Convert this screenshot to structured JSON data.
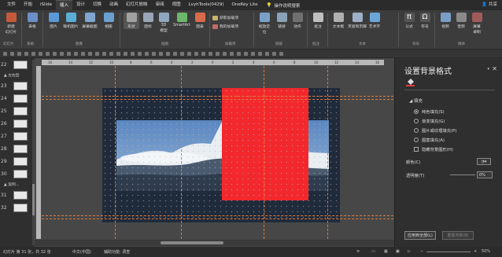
{
  "tabs": [
    {
      "label": "文件"
    },
    {
      "label": "开始"
    },
    {
      "label": "iSlide"
    },
    {
      "label": "插入",
      "active": true
    },
    {
      "label": "设计"
    },
    {
      "label": "切换"
    },
    {
      "label": "动画"
    },
    {
      "label": "幻灯片放映"
    },
    {
      "label": "审阅"
    },
    {
      "label": "视图"
    },
    {
      "label": "LvyhTools(0429)"
    },
    {
      "label": "OneKey Lite"
    }
  ],
  "tell_me": "操作说明搜索",
  "share": "共享",
  "ribbon": {
    "new_slide": "新建\n幻灯片",
    "table": "表格",
    "picture": "图片",
    "online_picture": "联机图片",
    "screenshot": "屏幕截图",
    "album": "相册",
    "shapes": "形状",
    "icons": "图标",
    "model3d": "3D\n模型",
    "smartart": "SmartArt",
    "chart": "图表",
    "get_addins": "获取加载项",
    "my_addins": "我的加载项",
    "zoom": "缩放定\n位",
    "link": "链接",
    "action": "动作",
    "comment": "批注",
    "textbox": "文本框",
    "header_footer": "页眉和页脚",
    "wordart": "艺术字",
    "formula": "公式",
    "symbol": "符号",
    "video": "视频",
    "audio": "音频",
    "screen_record": "屏幕\n录制",
    "groups": {
      "slides": "幻灯片",
      "table": "表格",
      "images": "图像",
      "illustrations": "插图",
      "addins": "加载项",
      "links": "链接",
      "comments": "批注",
      "text": "文本",
      "symbols": "符号",
      "media": "媒体"
    }
  },
  "thumbnails": [
    {
      "num": "22"
    },
    {
      "section": "▲ 左右型"
    },
    {
      "num": "23"
    },
    {
      "num": "24"
    },
    {
      "num": "25"
    },
    {
      "num": "26"
    },
    {
      "num": "27"
    },
    {
      "num": "28"
    },
    {
      "num": "29"
    },
    {
      "num": "30"
    },
    {
      "section": "▲ 案例..."
    },
    {
      "num": "31"
    },
    {
      "num": "32"
    }
  ],
  "ruler_ticks": [
    "16",
    "14",
    "12",
    "10",
    "8",
    "6",
    "4",
    "2",
    "0",
    "2",
    "4",
    "6",
    "8",
    "10",
    "12",
    "14",
    "16"
  ],
  "pane": {
    "title": "设置背景格式",
    "fill_heading": "◢ 填充",
    "options": [
      "纯色填充(S)",
      "渐变填充(G)",
      "图片或纹理填充(P)",
      "图案填充(A)"
    ],
    "hide_bg": "隐藏背景图形(H)",
    "color_label": "颜色(C)",
    "transparency_label": "透明度(T)",
    "transparency_value": "0%",
    "apply_all": "应用到全部(L)",
    "reset_bg": "重置背景(B)"
  },
  "status": {
    "slide_info": "幻灯片 第 31 张，共 32 张",
    "language": "中文(中国)",
    "accessibility": "辅助功能: 调查",
    "zoom": "50%"
  },
  "colors": {
    "slide_bg": "#1f2a3a",
    "red_rect": "#f2282c",
    "guide": "#e07a3a"
  }
}
